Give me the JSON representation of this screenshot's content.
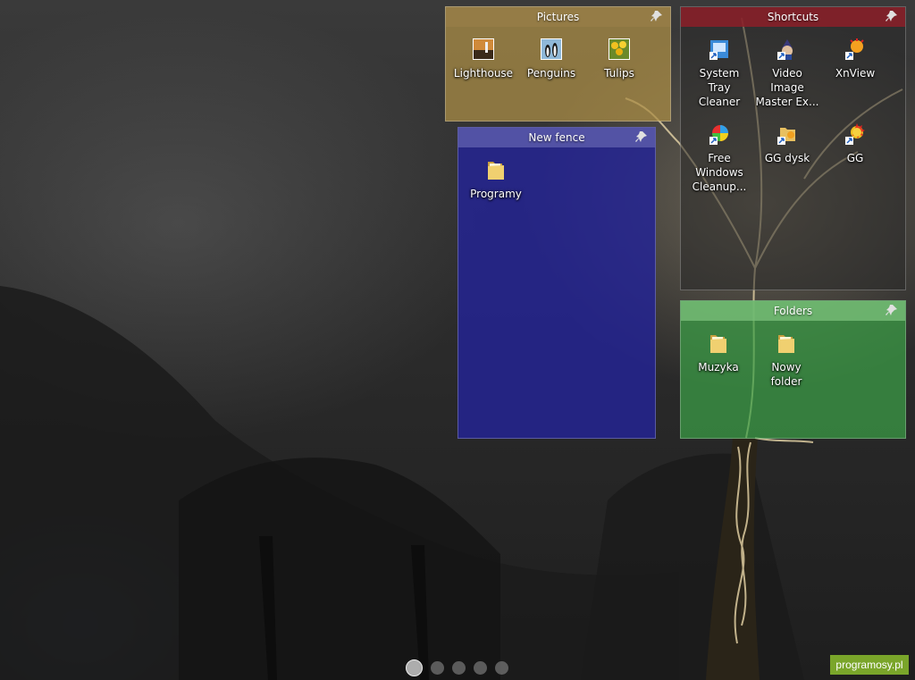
{
  "fences": {
    "pictures": {
      "title": "Pictures",
      "items": [
        {
          "label": "Lighthouse",
          "icon": "lighthouse-image-icon"
        },
        {
          "label": "Penguins",
          "icon": "penguins-image-icon"
        },
        {
          "label": "Tulips",
          "icon": "tulips-image-icon"
        }
      ]
    },
    "shortcuts": {
      "title": "Shortcuts",
      "items": [
        {
          "label": "System\nTray\nCleaner",
          "icon": "system-tray-cleaner-icon"
        },
        {
          "label": "Video\nImage\nMaster Ex...",
          "icon": "video-image-master-icon"
        },
        {
          "label": "XnView",
          "icon": "xnview-icon"
        },
        {
          "label": "Free\nWindows\nCleanup...",
          "icon": "free-windows-cleanup-icon"
        },
        {
          "label": "GG dysk",
          "icon": "gg-dysk-icon"
        },
        {
          "label": "GG",
          "icon": "gg-icon"
        }
      ]
    },
    "new_fence": {
      "title": "New fence",
      "items": [
        {
          "label": "Programy",
          "icon": "folder-icon"
        }
      ]
    },
    "folders": {
      "title": "Folders",
      "items": [
        {
          "label": "Muzyka",
          "icon": "folder-icon"
        },
        {
          "label": "Nowy\nfolder",
          "icon": "folder-icon"
        }
      ]
    }
  },
  "pager": {
    "pages": 5,
    "active": 1
  },
  "watermark": "programosy.pl",
  "colors": {
    "pictures_fence": "#aa8c46",
    "shortcuts_header": "#8c1e28",
    "new_fence": "#232396",
    "folders_fence": "#3ca046",
    "watermark_bg": "#7aa52a"
  }
}
